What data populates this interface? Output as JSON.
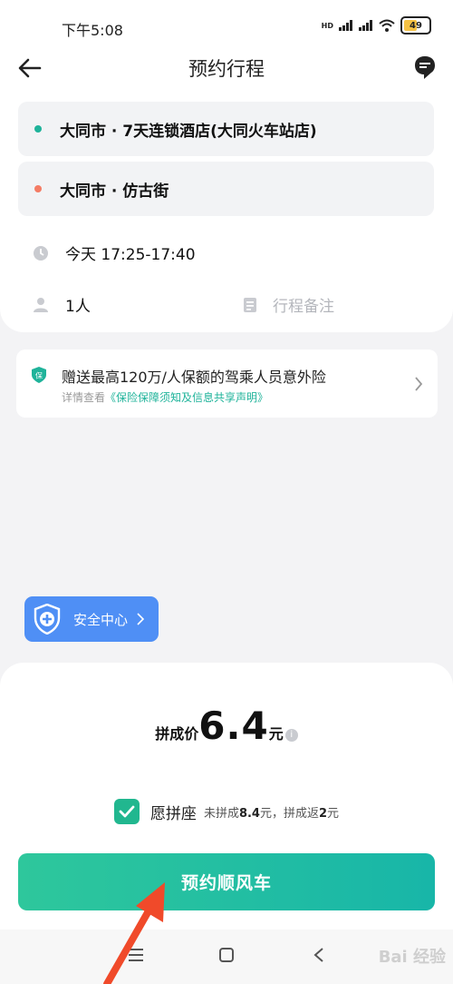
{
  "status_bar": {
    "time": "下午5:08",
    "network": "HD",
    "battery": "49"
  },
  "header": {
    "title": "预约行程"
  },
  "route": {
    "origin": {
      "text": "大同市 · 7天连锁酒店(大同火车站店)",
      "dot_color": "#1fb39a"
    },
    "destination": {
      "text": "大同市 · 仿古街",
      "dot_color": "#f47c65"
    }
  },
  "trip": {
    "time": "今天 17:25-17:40",
    "passengers": "1人",
    "remark_placeholder": "行程备注"
  },
  "insurance": {
    "title": "赠送最高120万/人保额的驾乘人员意外险",
    "sub_prefix": "详情查看",
    "sub_link": "《保险保障须知及信息共享声明》",
    "badge": "保"
  },
  "safety": {
    "label": "安全中心"
  },
  "price": {
    "label": "拼成价",
    "value": "6.4",
    "unit": "元",
    "info": "i"
  },
  "carpool": {
    "label": "愿拼座",
    "note_prefix": "未拼成",
    "note_price": "8.4",
    "note_mid": "元，拼成返",
    "note_refund": "2",
    "note_suffix": "元",
    "checked": true
  },
  "action": {
    "label": "预约顺风车"
  },
  "watermark": "Bai 经验",
  "colors": {
    "accent": "#1fb39a",
    "safety_blue": "#4f8ff5",
    "orange_dot": "#f47c65"
  }
}
